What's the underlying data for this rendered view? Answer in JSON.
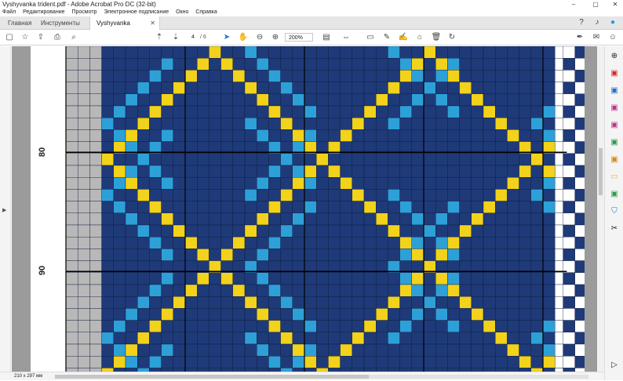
{
  "window": {
    "title": "Vyshyvanka trident.pdf - Adobe Acrobat Pro DC (32-bit)"
  },
  "menu": {
    "items": [
      "Файл",
      "Редактирование",
      "Просмотр",
      "Электронное подписание",
      "Окно",
      "Справка"
    ]
  },
  "tabs": {
    "home": "Главная",
    "tools": "Инструменты",
    "document": "Vyshyvanka trident..."
  },
  "toolbar": {
    "page_current": "4",
    "page_total": "/ 6",
    "zoom": "200%"
  },
  "grid": {
    "row_label_80": "80",
    "row_label_90": "90"
  },
  "status": {
    "page_size": "210 x 297 мм"
  },
  "colors": {
    "navy": "#1f3a78",
    "yellow": "#f2d21a",
    "cyan": "#2ea0d8",
    "gray": "#b8b8b8",
    "white": "#ffffff"
  },
  "icons": {
    "toolbar": [
      "create-icon",
      "star-icon",
      "upload-icon",
      "print-icon",
      "search-icon",
      "page-up-icon",
      "page-down-icon",
      "select-icon",
      "hand-icon",
      "zoom-out-icon",
      "zoom-in-icon",
      "fit-icon",
      "comment-icon",
      "highlight-icon",
      "sign-icon",
      "stamp-icon",
      "delete-icon",
      "rotate-icon",
      "fill-sign-icon",
      "mail-icon",
      "user-icon"
    ],
    "right_pane": [
      "zoom-icon",
      "export-pdf-icon",
      "edit-pdf-icon",
      "create-pdf-icon",
      "combine-icon",
      "organize-icon",
      "redact-icon",
      "comment-icon",
      "scan-icon",
      "protect-icon",
      "tools-more-icon"
    ]
  }
}
